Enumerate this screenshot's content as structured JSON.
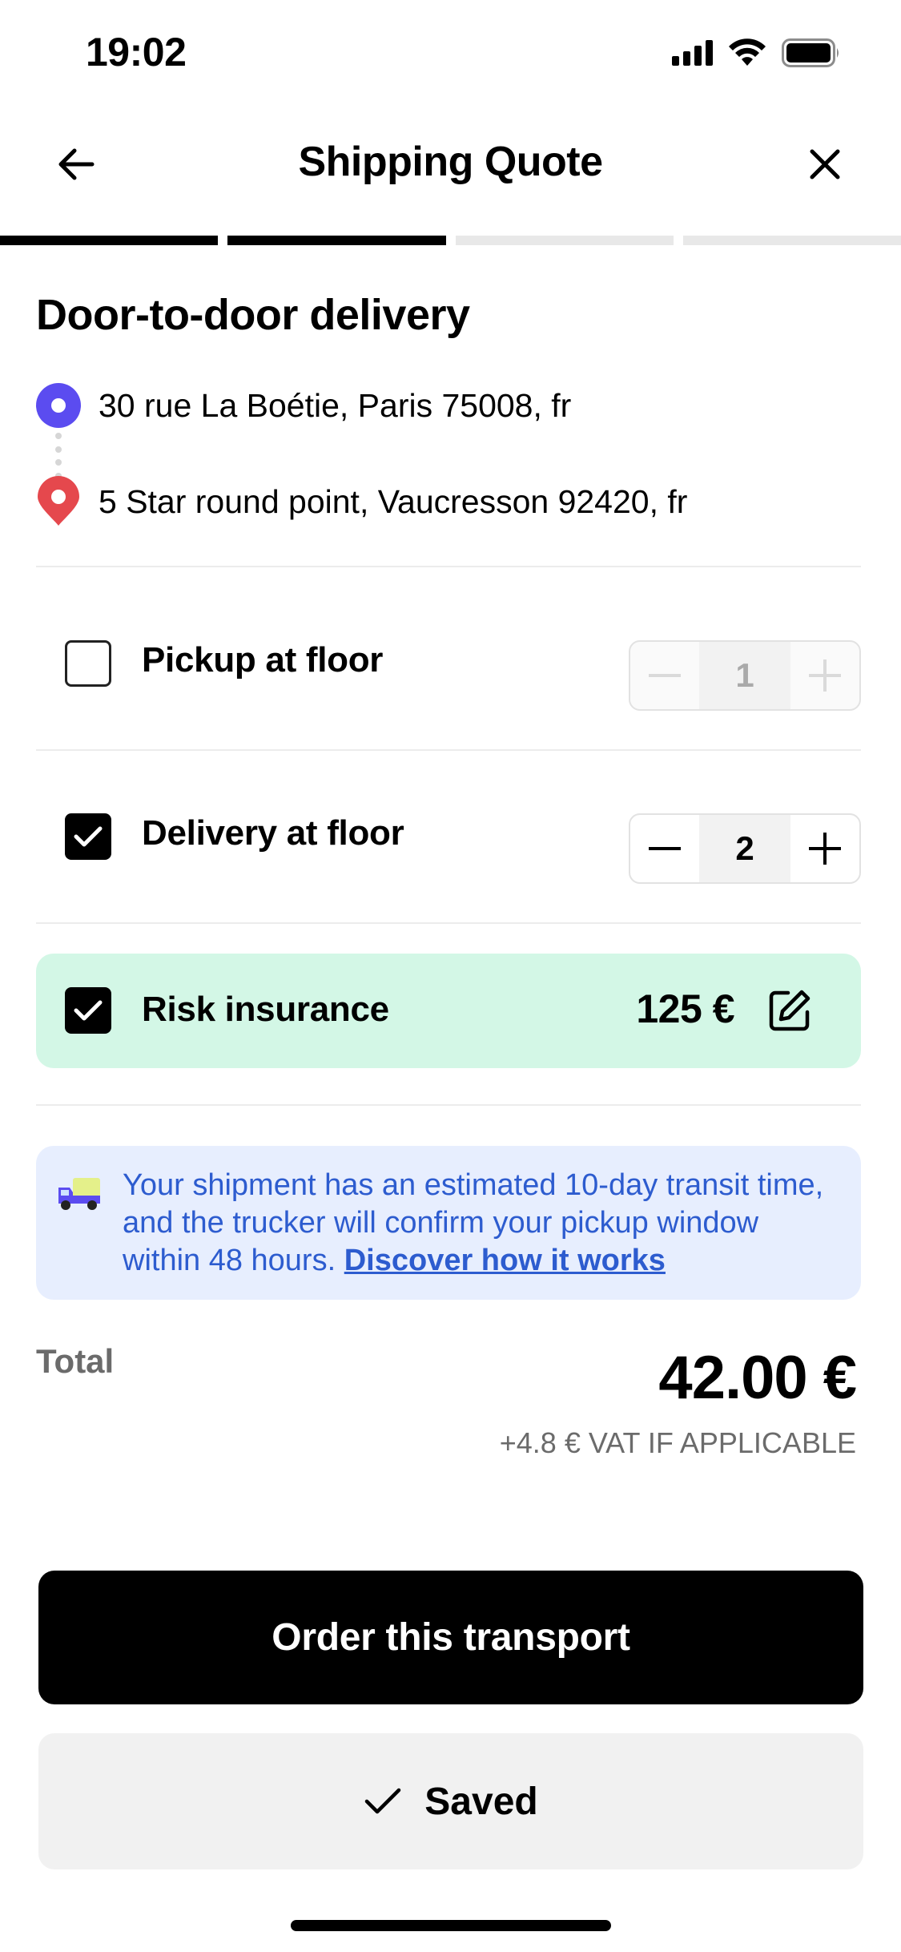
{
  "status_bar": {
    "time": "19:02"
  },
  "header": {
    "title": "Shipping Quote"
  },
  "progress": {
    "total_steps": 4,
    "completed_steps": 2
  },
  "delivery": {
    "title": "Door-to-door delivery",
    "origin": "30 rue La Boétie, Paris 75008, fr",
    "destination": "5 Star round point, Vaucresson 92420, fr"
  },
  "options": {
    "pickup": {
      "label": "Pickup at floor",
      "checked": false,
      "floor": "1"
    },
    "delivery": {
      "label": "Delivery at floor",
      "checked": true,
      "floor": "2"
    },
    "insurance": {
      "label": "Risk insurance",
      "checked": true,
      "amount": "125 €"
    }
  },
  "info": {
    "text": "Your shipment has an estimated 10-day transit time, and the trucker will confirm your pickup window within 48 hours.",
    "link": "Discover how it works"
  },
  "total": {
    "label": "Total",
    "amount": "42.00 €",
    "vat": "+4.8 € VAT IF APPLICABLE"
  },
  "actions": {
    "order_label": "Order this transport",
    "saved_label": "Saved"
  },
  "colors": {
    "origin_marker": "#5b4cf0",
    "destination_marker": "#e5484d",
    "insurance_bg": "#d3f7e6",
    "info_bg": "#e7eefe",
    "info_text": "#2d5ccf"
  }
}
